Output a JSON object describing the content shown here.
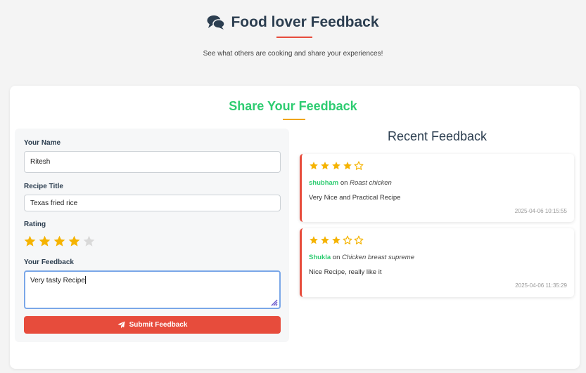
{
  "header": {
    "title": "Food lover Feedback",
    "subtitle": "See what others are cooking and share your experiences!",
    "icon": "comments-icon",
    "underline_color": "#e74c3c"
  },
  "form": {
    "section_title": "Share Your Feedback",
    "name_label": "Your Name",
    "name_value": "Ritesh",
    "recipe_label": "Recipe Title",
    "recipe_value": "Texas fried rice",
    "rating_label": "Rating",
    "rating_value": 4,
    "rating_max": 5,
    "feedback_label": "Your Feedback",
    "feedback_value": "Very tasty Recipe",
    "submit_label": "Submit Feedback",
    "submit_icon": "paper-plane-icon"
  },
  "recent": {
    "title": "Recent Feedback",
    "items": [
      {
        "rating": 4,
        "user": "shubham",
        "on": "on",
        "recipe": "Roast chicken",
        "text": "Very Nice and Practical Recipe",
        "timestamp": "2025-04-06 10:15:55"
      },
      {
        "rating": 3,
        "user": "Shukla",
        "on": "on",
        "recipe": "Chicken breast supreme",
        "text": "Nice Recipe, really like it",
        "timestamp": "2025-04-06 11:35:29"
      }
    ]
  },
  "colors": {
    "accent_red": "#e74c3c",
    "accent_green": "#2ecc71",
    "star_gold": "#f5b301",
    "star_empty": "#d9d9d9"
  }
}
